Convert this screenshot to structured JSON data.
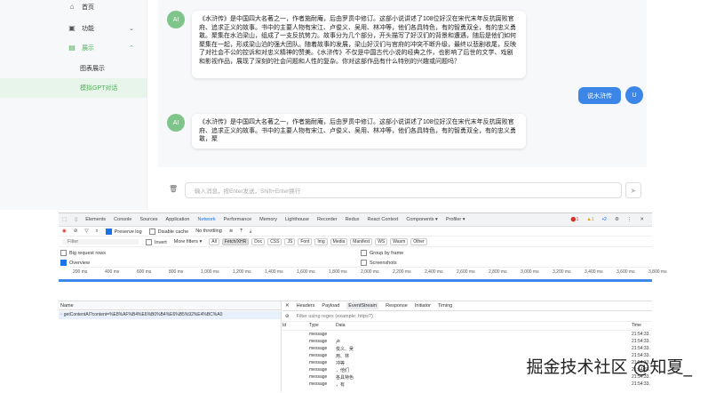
{
  "sidebar": {
    "items": [
      {
        "label": "首页",
        "icon": "home-icon",
        "glyph": "⌂"
      },
      {
        "label": "功能",
        "icon": "apps-icon",
        "glyph": "▣",
        "chevron": "⌄"
      },
      {
        "label": "展示",
        "icon": "display-icon",
        "glyph": "▤",
        "chevron": "⌃"
      }
    ],
    "sub_items": [
      {
        "label": "图表展示"
      },
      {
        "label": "模拟GPT对话"
      }
    ]
  },
  "chat": {
    "messages": [
      {
        "role": "ai",
        "avatar": "AI",
        "text": "《水浒传》是中国四大名著之一，作者施耐庵，后由罗贯中修订。这部小说讲述了108位好汉在宋代末年反抗腐败官府、追求正义的故事。书中的主要人物有宋江、卢俊义、吴用、林冲等，他们各具特色，有的智勇双全，有的忠义勇敢。聚集在水泊梁山，组成了一支反抗势力。故事分为几个部分，开头描写了好汉们的背景和遭遇，随后是他们如何聚集在一起，形成梁山泊的强大团队。随着故事的发展，梁山好汉们与官府的冲突不断升级，最终以悲剧收尾，反映了对社会不公的控诉和对忠义精神的赞美。《水浒传》不仅是中国古代小说的经典之作，也影响了后世的文学、戏剧和影视作品，展现了深刻的社会问题和人性的复杂。你对这部作品有什么特别的兴趣或问题吗？"
      },
      {
        "role": "user",
        "avatar": "U",
        "text": "说水浒传"
      },
      {
        "role": "ai",
        "avatar": "AI",
        "text": "《水浒传》是中国四大名著之一，作者施耐庵，后由罗贯中修订。这部小说讲述了108位好汉在宋代末年反抗腐败官府、追求正义的故事。书中的主要人物有宋江、卢俊义、吴用、林冲等，他们各具特色，有的智勇双全，有的忠义勇敢，聚"
      }
    ],
    "input_placeholder": "输入消息，按Enter发送，Shift+Enter换行",
    "send_glyph": "➤",
    "trash_glyph": "🗑"
  },
  "devtools": {
    "tabs": [
      "Elements",
      "Console",
      "Sources",
      "Application",
      "Network",
      "Performance",
      "Memory",
      "Lighthouse",
      "Recorder",
      "Redux",
      "React Context",
      "Components ▾",
      "Profiler ▾"
    ],
    "selected_tab": "Network",
    "status": {
      "errors": "1",
      "warnings": "1",
      "info": "2"
    },
    "toolbar": {
      "preserve_log": "Preserve log",
      "disable_cache": "Disable cache",
      "throttling": "No throttling"
    },
    "filter": {
      "placeholder": "Filter",
      "invert": "Invert",
      "more_filters": "More filters ▾"
    },
    "type_filters": [
      "All",
      "Fetch/XHR",
      "Doc",
      "CSS",
      "JS",
      "Font",
      "Img",
      "Media",
      "Manifest",
      "WS",
      "Wasm",
      "Other"
    ],
    "selected_type": "Fetch/XHR",
    "options": {
      "big_request_rows": "Big request rows",
      "overview": "Overview",
      "group_by_frame": "Group by frame",
      "screenshots": "Screenshots"
    },
    "timeline_ticks": [
      "200 ms",
      "400 ms",
      "600 ms",
      "800 ms",
      "1,000 ms",
      "1,200 ms",
      "1,400 ms",
      "1,600 ms",
      "1,800 ms",
      "2,000 ms",
      "2,200 ms",
      "2,400 ms",
      "2,600 ms",
      "2,800 ms",
      "3,000 ms",
      "3,200 ms",
      "3,400 ms",
      "3,600 ms",
      "3,800 ms"
    ],
    "request_list": {
      "header": "Name",
      "request": "getContentAI?content=%E8%AF%B4%E6%B0%B4%E6%B5%92%E4%BC%A0"
    },
    "detail_tabs": [
      "Headers",
      "Payload",
      "EventStream",
      "Response",
      "Initiator",
      "Timing"
    ],
    "selected_detail_tab": "EventStream",
    "regex_filter": "Filter using regex (example: https?)",
    "event_columns": [
      "Id",
      "Type",
      "Data",
      "Time"
    ],
    "events": [
      {
        "type": "message",
        "data": "",
        "time": "21:54:33."
      },
      {
        "type": "message",
        "data": "卢",
        "time": "21:54:33."
      },
      {
        "type": "message",
        "data": "俊义、吴",
        "time": "21:54:33."
      },
      {
        "type": "message",
        "data": "用、林",
        "time": "21:54:33."
      },
      {
        "type": "message",
        "data": "冲等",
        "time": "21:54:33."
      },
      {
        "type": "message",
        "data": "，他们",
        "time": "21:54:33."
      },
      {
        "type": "message",
        "data": "各具特色",
        "time": "21:54:33."
      },
      {
        "type": "message",
        "data": "，有",
        "time": "21:54:33."
      }
    ]
  },
  "watermark": "掘金技术社区 @知夏_"
}
